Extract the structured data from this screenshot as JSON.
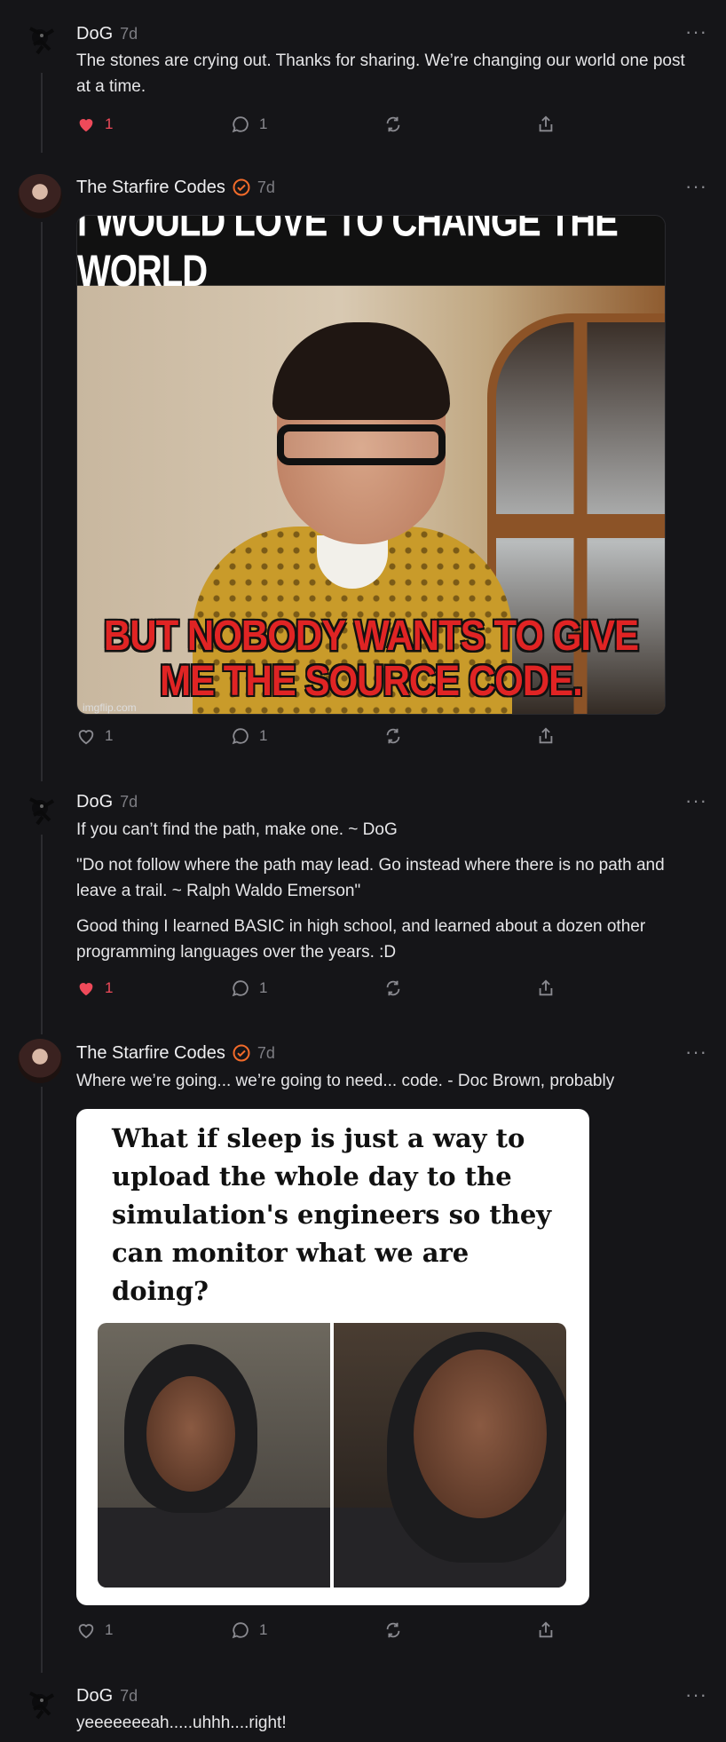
{
  "posts": [
    {
      "author": "DoG",
      "time": "7d",
      "verified": false,
      "paragraphs": [
        "The stones are crying out. Thanks for sharing. We’re changing our world one post at a time."
      ],
      "likes": "1",
      "liked": true,
      "replies": "1"
    },
    {
      "author": "The Starfire Codes",
      "time": "7d",
      "verified": true,
      "paragraphs": [],
      "image": {
        "top_text": "I WOULD LOVE TO CHANGE THE WORLD",
        "bottom_text": "BUT NOBODY WANTS TO GIVE ME THE SOURCE CODE.",
        "watermark": "imgflip.com"
      },
      "likes": "1",
      "liked": false,
      "replies": "1"
    },
    {
      "author": "DoG",
      "time": "7d",
      "verified": false,
      "paragraphs": [
        "If you can’t find the path, make one. ~ DoG",
        "\"Do not follow where the path may lead. Go instead where there is no path and leave a trail. ~ Ralph Waldo Emerson\"",
        "Good thing I learned BASIC in high school, and learned about a dozen other programming languages over the years. :D"
      ],
      "likes": "1",
      "liked": true,
      "replies": "1"
    },
    {
      "author": "The Starfire Codes",
      "time": "7d",
      "verified": true,
      "paragraphs": [
        "Where we’re going... we’re going to need... code. - Doc Brown, probably"
      ],
      "image": {
        "caption": "What if sleep is just a way to upload the whole day to the simulation's engineers so they can monitor what we are doing?"
      },
      "likes": "1",
      "liked": false,
      "replies": "1"
    },
    {
      "author": "DoG",
      "time": "7d",
      "verified": false,
      "paragraphs": [
        "yeeeeeeeah.....uhhh....right!"
      ]
    }
  ],
  "colors": {
    "background": "#151518",
    "like": "#ef4a5a",
    "verified": "#f26b2a",
    "muted": "#8a8a90"
  },
  "icons": [
    "heart-icon",
    "reply-icon",
    "repost-icon",
    "share-icon",
    "more-icon",
    "verified-icon"
  ]
}
